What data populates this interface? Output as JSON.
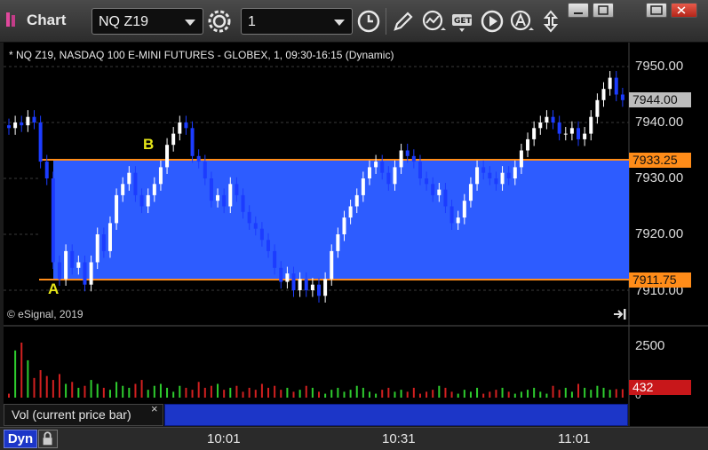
{
  "window": {
    "title": "Chart",
    "symbol": "NQ Z19",
    "interval": "1",
    "colors": {
      "accent": "#1c36c8",
      "range_fill": "#2d5cff",
      "range_line": "#ff8c19",
      "up": "#ffffff",
      "down": "#1c3cff"
    }
  },
  "toolbar": {
    "icons": [
      "gear-icon",
      "clock-icon",
      "pencil-icon",
      "study-icon",
      "get-icon",
      "play-icon",
      "alert-icon",
      "move-icon"
    ],
    "window_buttons": [
      "minimize-icon",
      "maximize-icon",
      "restore-icon",
      "close-icon"
    ]
  },
  "chart": {
    "header": "* NQ Z19, NASDAQ 100 E-MINI FUTURES - GLOBEX, 1, 09:30-16:15 (Dynamic)",
    "copyright": "© eSignal, 2019",
    "label_a": "A",
    "label_b": "B",
    "last_price": "7944.00",
    "range_high_tag": "7933.25",
    "range_low_tag": "7911.75",
    "y_ticks": [
      "7950.00",
      "7940.00",
      "7930.00",
      "7920.00",
      "7910.00"
    ]
  },
  "volume": {
    "label": "Vol (current price bar)",
    "close": "×",
    "y_ticks": [
      "2500",
      "0"
    ],
    "last_volume": "432"
  },
  "bottom": {
    "mode": "Dyn",
    "x_ticks": [
      "10:01",
      "10:31",
      "11:01"
    ]
  },
  "chart_data": {
    "type": "candlestick",
    "price_range": {
      "high": 7933.25,
      "low": 7911.75
    },
    "y_axis": [
      7910,
      7920,
      7930,
      7940,
      7950
    ],
    "closes": [
      7939,
      7940,
      7939.5,
      7941,
      7940,
      7933,
      7930,
      7915,
      7912,
      7917,
      7914,
      7915,
      7911,
      7915,
      7920,
      7917,
      7922,
      7927,
      7929,
      7931,
      7927,
      7925,
      7927,
      7929,
      7932,
      7936,
      7938,
      7940,
      7939,
      7934,
      7933,
      7930,
      7926,
      7927,
      7925,
      7929,
      7927,
      7924,
      7922,
      7921,
      7919,
      7917,
      7914,
      7911.5,
      7913,
      7910,
      7912,
      7910,
      7911,
      7909,
      7912,
      7917,
      7920,
      7923,
      7925,
      7927,
      7930,
      7932,
      7933,
      7931,
      7929,
      7932,
      7935,
      7934,
      7933,
      7930,
      7929,
      7927,
      7928,
      7925,
      7922,
      7923,
      7926,
      7929,
      7932,
      7931,
      7930,
      7929,
      7931,
      7930,
      7932,
      7935,
      7937,
      7939,
      7940,
      7941,
      7940,
      7938,
      7938,
      7939,
      7937,
      7938,
      7941,
      7944,
      7946,
      7948,
      7945,
      7944
    ],
    "volume_levels": [
      200,
      2400,
      2800,
      1900,
      1000,
      1400,
      1100,
      900,
      1200,
      700,
      800,
      500,
      600,
      900,
      700,
      500,
      400,
      800,
      600,
      500,
      700,
      900,
      400,
      600,
      700,
      500,
      300,
      600,
      500,
      400,
      800,
      500,
      600,
      700,
      400,
      500,
      600,
      300,
      500,
      400,
      700,
      500,
      600,
      400,
      500,
      300,
      400,
      600,
      500,
      300,
      200,
      400,
      500,
      300,
      400,
      600,
      500,
      300,
      200,
      400,
      500,
      300,
      400,
      300,
      500,
      200,
      300,
      400,
      600,
      500,
      300,
      200,
      400,
      300,
      500,
      200,
      300,
      400,
      500,
      300,
      200,
      300,
      400,
      500,
      300,
      200,
      600,
      400,
      500,
      300,
      700,
      500,
      400,
      600,
      500,
      400,
      432,
      432
    ]
  }
}
